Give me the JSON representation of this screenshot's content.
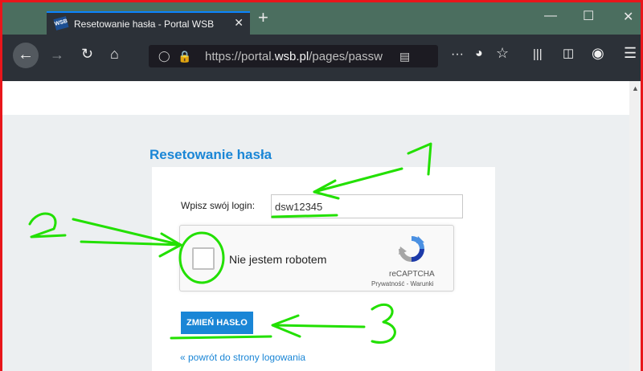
{
  "browser": {
    "tab_title": "Resetowanie hasła - Portal WSB",
    "tab_close": "✕",
    "favicon_text": "WSB",
    "new_tab": "+",
    "url_prefix": "https://portal.",
    "url_domain": "wsb.pl",
    "url_path": "/pages/passw",
    "overflow_menu": "···",
    "menu": "☰"
  },
  "page": {
    "heading": "Resetowanie hasła",
    "login_label": "Wpisz swój login:",
    "login_value": "dsw12345",
    "captcha_label": "Nie jestem robotem",
    "captcha_brand": "reCAPTCHA",
    "captcha_links": "Prywatność - Warunki",
    "submit_label": "ZMIEŃ HASŁO",
    "back_link": "« powrót do strony logowania"
  },
  "annotations": {
    "marker_1": "1",
    "marker_2": "2",
    "marker_3": "3",
    "color": "#22e000"
  },
  "colors": {
    "frame_border": "#e8161b",
    "tab_strip": "#4b6e5f",
    "toolbar": "#2c3138",
    "accent": "#1a86d6"
  }
}
